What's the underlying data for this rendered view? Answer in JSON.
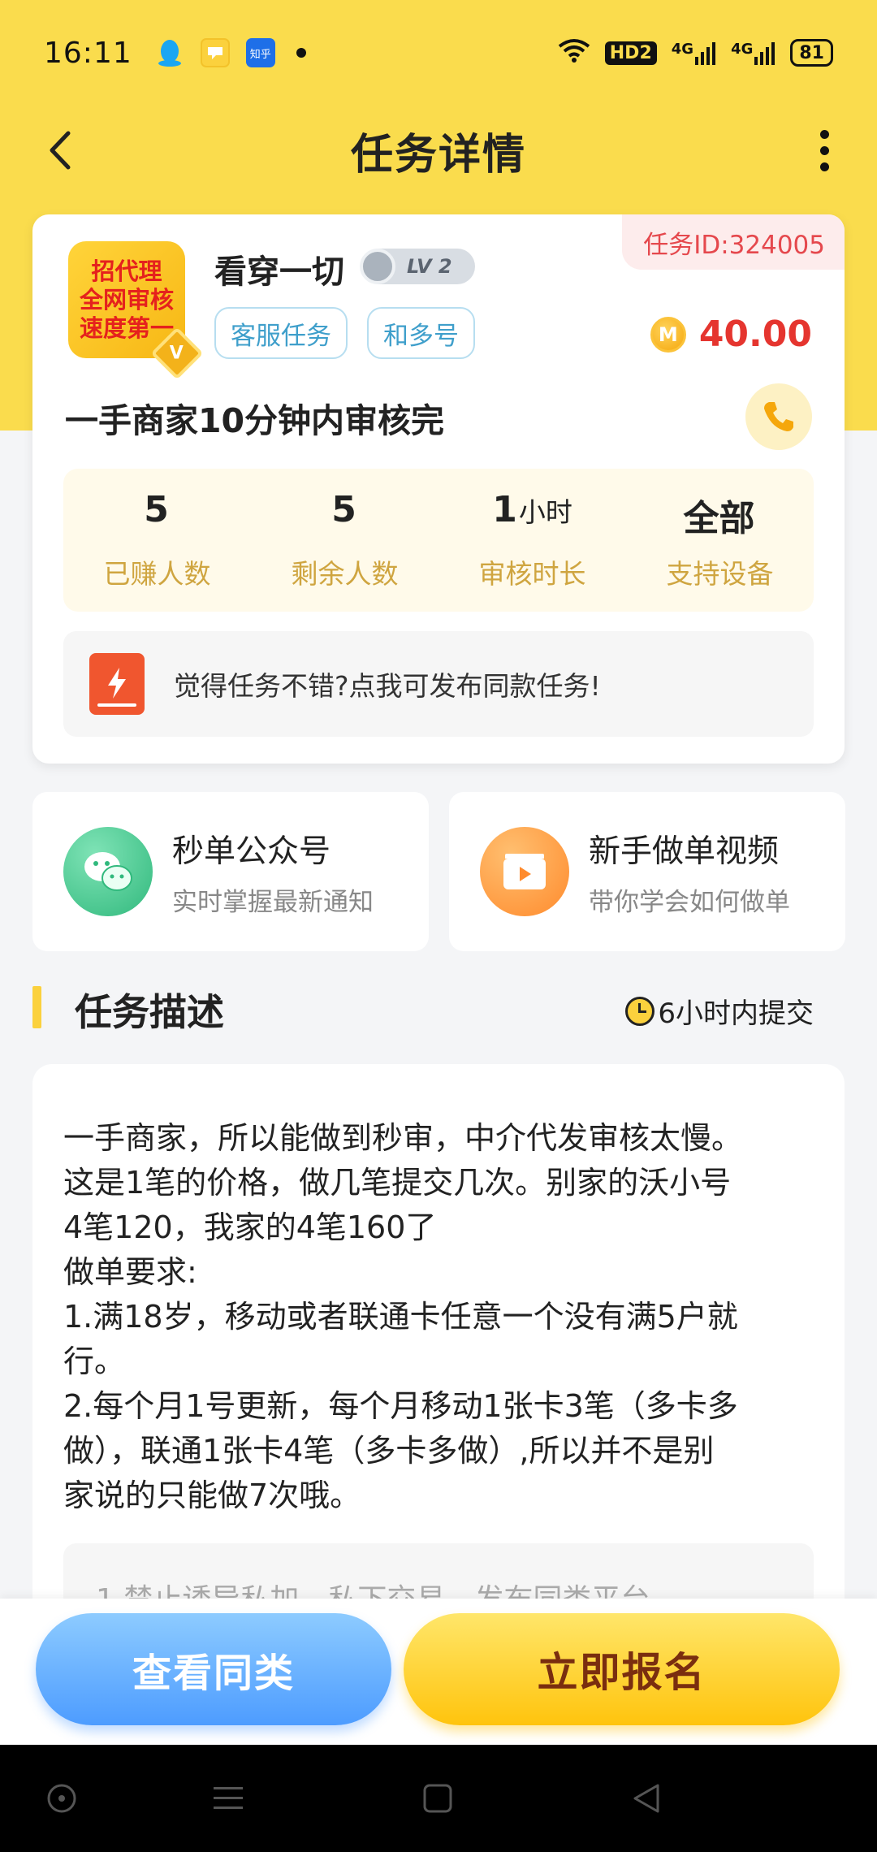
{
  "status_bar": {
    "time": "16:11",
    "apps": [
      "qq-icon",
      "chat-app-icon",
      "zhihu-icon"
    ],
    "zhihu_label": "知乎",
    "hd_label": "HD2",
    "signal1": "4G",
    "signal2": "4G",
    "battery": "81"
  },
  "header": {
    "title": "任务详情"
  },
  "task": {
    "id_label": "任务ID:324005",
    "logo_lines": [
      "招代理",
      "全网审核",
      "速度第一"
    ],
    "logo_badge": "V",
    "user_name": "看穿一切",
    "level": "LV 2",
    "tags": [
      "客服任务",
      "和多号"
    ],
    "coin_symbol": "M",
    "price": "40.00",
    "title": "一手商家10分钟内审核完",
    "stats": [
      {
        "value": "5",
        "unit": "",
        "label": "已赚人数"
      },
      {
        "value": "5",
        "unit": "",
        "label": "剩余人数"
      },
      {
        "value": "1",
        "unit": "小时",
        "label": "审核时长"
      },
      {
        "value": "全部",
        "unit": "",
        "label": "支持设备"
      }
    ],
    "publish_prompt": "觉得任务不错?点我可发布同款任务!"
  },
  "features": [
    {
      "title": "秒单公众号",
      "subtitle": "实时掌握最新通知",
      "icon": "wechat-icon"
    },
    {
      "title": "新手做单视频",
      "subtitle": "带你学会如何做单",
      "icon": "video-icon"
    }
  ],
  "description": {
    "section_title": "任务描述",
    "deadline": "6小时内提交",
    "lines": [
      "一手商家，所以能做到秒审，中介代发审核太慢。",
      "这是1笔的价格，做几笔提交几次。别家的沃小号",
      "4笔120，我家的4笔160了",
      "做单要求:",
      "1.满18岁，移动或者联通卡任意一个没有满5户就",
      "行。",
      "2.每个月1号更新，每个月移动1张卡3笔（多卡多",
      "做），联通1张卡4笔（多卡多做）,所以并不是别",
      "家说的只能做7次哦。"
    ],
    "rules_preview": "1.禁止诱导私加、私下交易、发布同类平台"
  },
  "actions": {
    "similar_label": "查看同类",
    "signup_label": "立即报名"
  },
  "colors": {
    "brand_yellow": "#fadc4d",
    "price_red": "#e5352f",
    "tag_blue": "#3f9fcb",
    "stat_label_gold": "#cfa540"
  }
}
